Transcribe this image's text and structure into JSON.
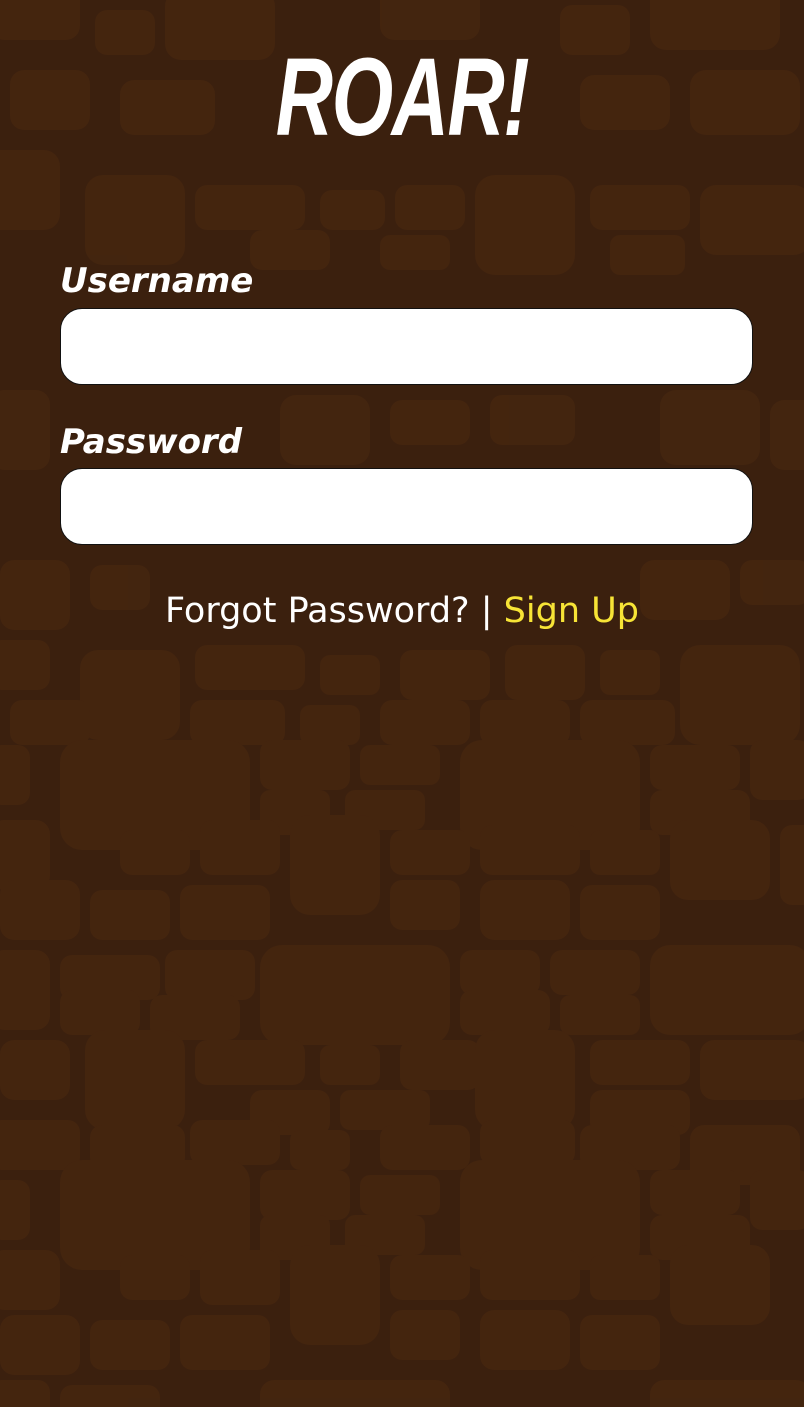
{
  "app": {
    "logo_text": "ROAR!"
  },
  "form": {
    "username_label": "Username",
    "password_label": "Password",
    "username_value": "",
    "password_value": ""
  },
  "links": {
    "forgot_password": "Forgot Password?",
    "separator": " | ",
    "sign_up": "Sign Up"
  },
  "colors": {
    "background": "#3b200e",
    "pattern": "#44240f",
    "accent": "#f7e436",
    "text": "#ffffff"
  }
}
